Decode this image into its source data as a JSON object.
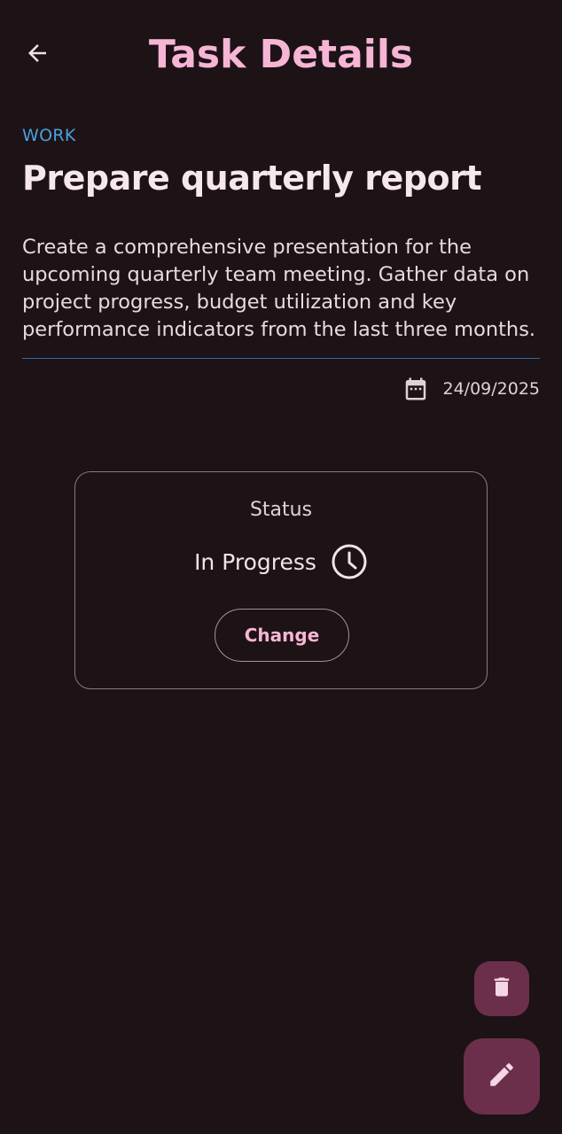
{
  "header": {
    "title": "Task Details",
    "back_icon": "arrow-left-icon"
  },
  "task": {
    "category": "WORK",
    "title": "Prepare quarterly report",
    "description": "Create a comprehensive presentation for the upcoming quarterly team meeting. Gather data on project progress, budget utilization and key performance indicators from the last three months.",
    "date": "24/09/2025",
    "date_icon": "calendar-icon"
  },
  "status_card": {
    "label": "Status",
    "value": "In Progress",
    "status_icon": "clock-icon",
    "change_label": "Change"
  },
  "fabs": {
    "delete_icon": "trash-icon",
    "edit_icon": "pencil-icon"
  },
  "colors": {
    "background": "#1d1216",
    "accent_pink": "#f7b5d5",
    "category_blue": "#4aa0e0",
    "fab_background": "#6b2f4b"
  }
}
